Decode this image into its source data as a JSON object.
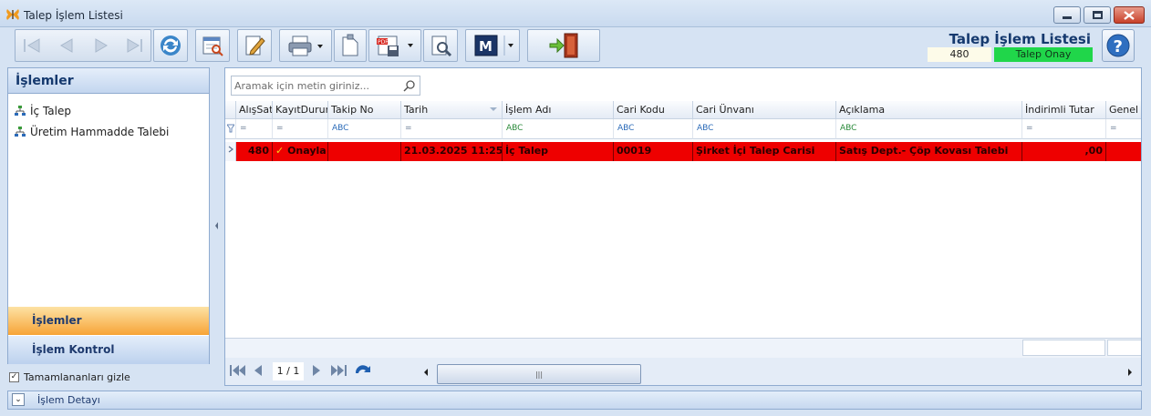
{
  "window": {
    "title": "Talep İşlem Listesi",
    "buttons": [
      "minimize-icon",
      "maximize-icon",
      "close-icon"
    ]
  },
  "toolbar": {
    "icons": [
      "first-record-icon",
      "previous-record-icon",
      "next-record-icon",
      "last-record-icon",
      "refresh-icon",
      "preview-icon",
      "edit-icon",
      "print-icon",
      "clipboard-icon",
      "pdf-export-icon",
      "settings-icon",
      "m-report-icon",
      "exit-door-icon"
    ]
  },
  "header": {
    "title": "Talep İşlem Listesi",
    "count": "480",
    "status": "Talep Onay",
    "status_color": "#20d64a"
  },
  "left_panel": {
    "title": "İşlemler",
    "items": [
      {
        "label": "İç Talep",
        "icon": "tree-hierarchy-icon"
      },
      {
        "label": "Üretim Hammadde Talebi",
        "icon": "tree-hierarchy-icon"
      }
    ],
    "nav_active": "İşlemler",
    "nav_inactive": "İşlem Kontrol",
    "hide_completed_label": "Tamamlananları gizle",
    "hide_completed_checked": true
  },
  "grid": {
    "search_placeholder": "Aramak için metin giriniz...",
    "columns": [
      "AlışSatış",
      "KayıtDurum",
      "Takip No",
      "Tarih",
      "İşlem Adı",
      "Cari Kodu",
      "Cari Ünvanı",
      "Açıklama",
      "İndirimli Tutar",
      "Genel T"
    ],
    "filters": [
      "=",
      "=",
      "ABC",
      "=",
      "ABC",
      "ABC",
      "ABC",
      "ABC",
      "=",
      "="
    ],
    "rows": [
      {
        "cells": [
          "480",
          "Onayla",
          "",
          "21.03.2025 11:25:0",
          "İç Talep",
          "00019",
          "Şirket İçi Talep Carisi",
          "Satış Dept.- Çöp Kovası Talebi",
          ",00",
          ""
        ],
        "row_color": "#ee0000"
      }
    ],
    "pager": {
      "page": "1 / 1"
    }
  },
  "bottom": {
    "label": "İşlem Detayı"
  }
}
